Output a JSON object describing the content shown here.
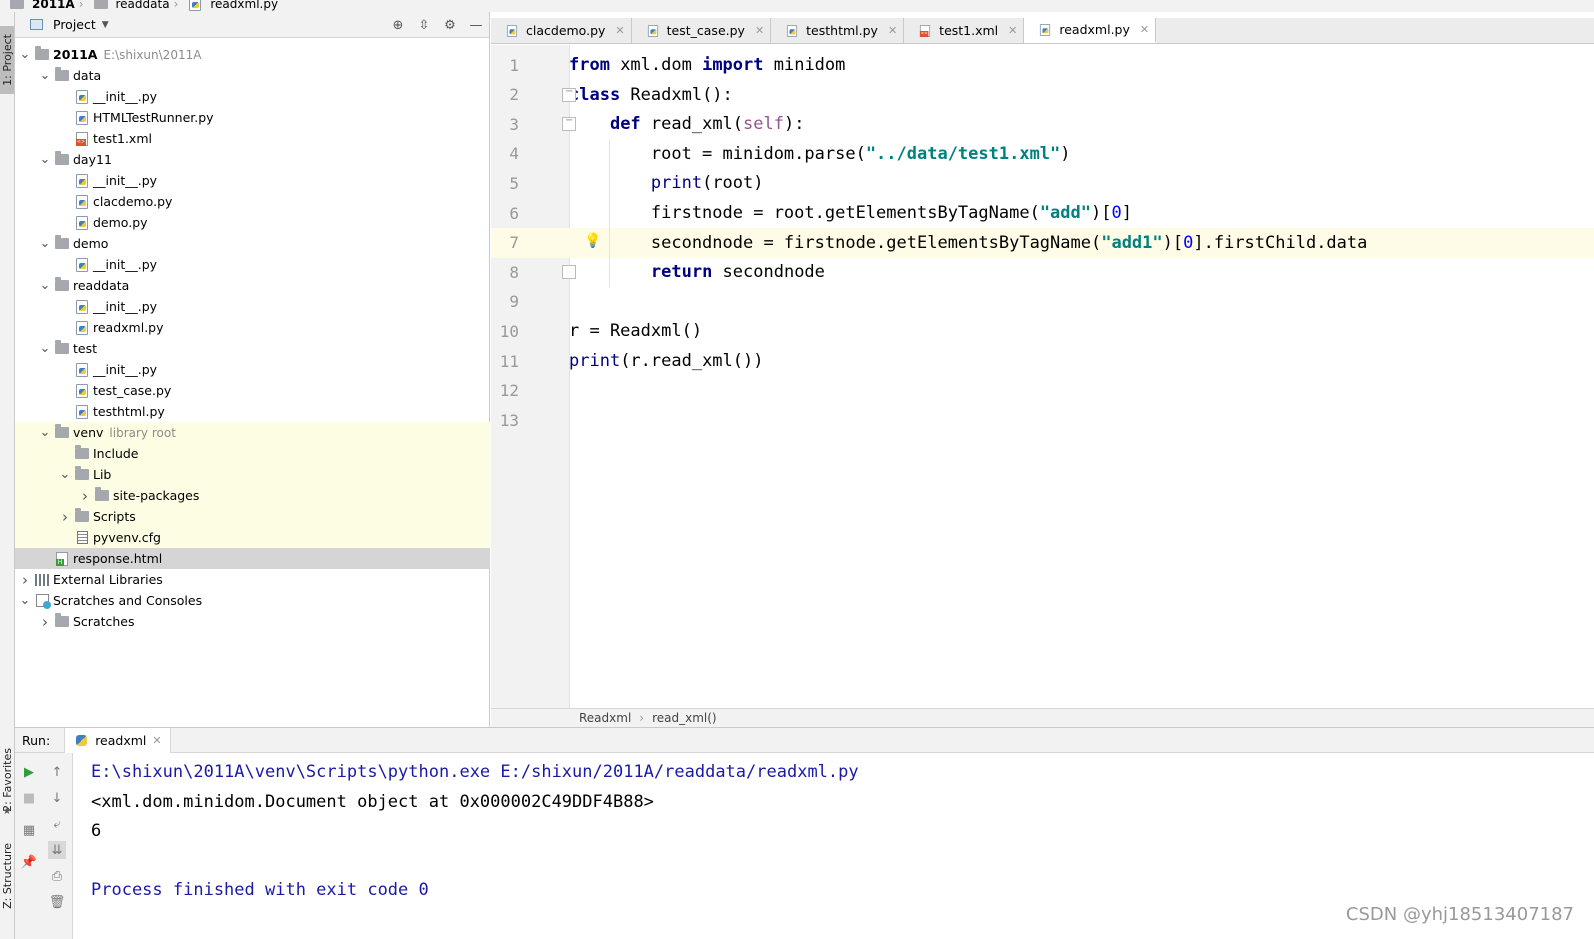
{
  "breadcrumb": [
    {
      "label": "2011A",
      "bold": true
    },
    {
      "label": "readdata",
      "bold": false
    },
    {
      "label": "readxml.py",
      "bold": false
    }
  ],
  "tool_strip": {
    "project_tab": "1: Project",
    "favorites_tab": "2: Favorites",
    "structure_tab": "Z: Structure"
  },
  "project_panel": {
    "title": "Project",
    "tree": [
      {
        "depth": 0,
        "expanded": true,
        "icon": "folder",
        "label": "2011A",
        "bold": true,
        "hint": "E:\\shixun\\2011A"
      },
      {
        "depth": 1,
        "expanded": true,
        "icon": "folder",
        "label": "data"
      },
      {
        "depth": 2,
        "icon": "python-file",
        "label": "__init__.py"
      },
      {
        "depth": 2,
        "icon": "python-file",
        "label": "HTMLTestRunner.py"
      },
      {
        "depth": 2,
        "icon": "xml-file",
        "label": "test1.xml"
      },
      {
        "depth": 1,
        "expanded": true,
        "icon": "folder",
        "label": "day11"
      },
      {
        "depth": 2,
        "icon": "python-file",
        "label": "__init__.py"
      },
      {
        "depth": 2,
        "icon": "python-file",
        "label": "clacdemo.py"
      },
      {
        "depth": 2,
        "icon": "python-file",
        "label": "demo.py"
      },
      {
        "depth": 1,
        "expanded": true,
        "icon": "folder",
        "label": "demo"
      },
      {
        "depth": 2,
        "icon": "python-file",
        "label": "__init__.py"
      },
      {
        "depth": 1,
        "expanded": true,
        "icon": "folder",
        "label": "readdata"
      },
      {
        "depth": 2,
        "icon": "python-file",
        "label": "__init__.py"
      },
      {
        "depth": 2,
        "icon": "python-file",
        "label": "readxml.py"
      },
      {
        "depth": 1,
        "expanded": true,
        "icon": "folder",
        "label": "test"
      },
      {
        "depth": 2,
        "icon": "python-file",
        "label": "__init__.py"
      },
      {
        "depth": 2,
        "icon": "python-file",
        "label": "test_case.py"
      },
      {
        "depth": 2,
        "icon": "python-file",
        "label": "testhtml.py"
      },
      {
        "depth": 1,
        "expanded": true,
        "icon": "folder",
        "label": "venv",
        "hint": "library root",
        "venv": true
      },
      {
        "depth": 2,
        "icon": "folder",
        "label": "Include",
        "venv": true
      },
      {
        "depth": 2,
        "expanded": true,
        "icon": "folder",
        "label": "Lib",
        "venv": true
      },
      {
        "depth": 3,
        "expanded": false,
        "icon": "folder",
        "label": "site-packages",
        "venv": true
      },
      {
        "depth": 2,
        "expanded": false,
        "icon": "folder",
        "label": "Scripts",
        "venv": true
      },
      {
        "depth": 2,
        "icon": "cfg-file",
        "label": "pyvenv.cfg",
        "venv": true
      },
      {
        "depth": 1,
        "icon": "html-file",
        "label": "response.html",
        "selected": true
      },
      {
        "depth": 0,
        "expanded": false,
        "icon": "library",
        "label": "External Libraries"
      },
      {
        "depth": 0,
        "expanded": true,
        "icon": "scratch",
        "label": "Scratches and Consoles"
      },
      {
        "depth": 1,
        "expanded": false,
        "icon": "folder",
        "label": "Scratches"
      }
    ]
  },
  "editor_tabs": [
    {
      "label": "clacdemo.py",
      "icon": "python-file",
      "active": false
    },
    {
      "label": "test_case.py",
      "icon": "python-file",
      "active": false
    },
    {
      "label": "testhtml.py",
      "icon": "python-file",
      "active": false
    },
    {
      "label": "test1.xml",
      "icon": "xml-file",
      "active": false
    },
    {
      "label": "readxml.py",
      "icon": "python-file",
      "active": true
    }
  ],
  "editor": {
    "current_line": 7,
    "line_numbers": [
      "1",
      "2",
      "3",
      "4",
      "5",
      "6",
      "7",
      "8",
      "9",
      "10",
      "11",
      "12",
      "13"
    ],
    "lines": [
      [
        {
          "t": "from",
          "c": "kw"
        },
        {
          "t": " xml.dom "
        },
        {
          "t": "import",
          "c": "kw"
        },
        {
          "t": " minidom"
        }
      ],
      [
        {
          "t": "class",
          "c": "kw"
        },
        {
          "t": " Readxml():"
        }
      ],
      [
        {
          "t": "    "
        },
        {
          "t": "def",
          "c": "kw"
        },
        {
          "t": " read_xml("
        },
        {
          "t": "self",
          "c": "self"
        },
        {
          "t": "):"
        }
      ],
      [
        {
          "t": "        root = minidom.parse("
        },
        {
          "t": "\"../data/test1.xml\"",
          "c": "str"
        },
        {
          "t": ")"
        }
      ],
      [
        {
          "t": "        "
        },
        {
          "t": "print",
          "c": "builtin"
        },
        {
          "t": "(root)"
        }
      ],
      [
        {
          "t": "        firstnode = root.getElementsByTagName("
        },
        {
          "t": "\"add\"",
          "c": "str"
        },
        {
          "t": ")["
        },
        {
          "t": "0",
          "c": "num"
        },
        {
          "t": "]"
        }
      ],
      [
        {
          "t": "        secondnode = firstnode.getElementsByTagName("
        },
        {
          "t": "\"add1\"",
          "c": "str"
        },
        {
          "t": ")["
        },
        {
          "t": "0",
          "c": "num"
        },
        {
          "t": "].firstChild.data"
        }
      ],
      [
        {
          "t": "        "
        },
        {
          "t": "return",
          "c": "kw"
        },
        {
          "t": " secondnode"
        }
      ],
      [],
      [
        {
          "t": "r = Readxml()"
        }
      ],
      [
        {
          "t": "print",
          "c": "builtin"
        },
        {
          "t": "(r.read_xml())"
        }
      ],
      [],
      []
    ],
    "breadcrumb": [
      "Readxml",
      "read_xml()"
    ]
  },
  "run_panel": {
    "label": "Run:",
    "tab_label": "readxml",
    "output": [
      {
        "text": "E:\\shixun\\2011A\\venv\\Scripts\\python.exe E:/shixun/2011A/readdata/readxml.py",
        "color": "#1a1aa6"
      },
      {
        "text": "<xml.dom.minidom.Document object at 0x000002C49DDF4B88>",
        "color": "#000000"
      },
      {
        "text": "6",
        "color": "#000000"
      },
      {
        "text": "",
        "color": "#000000"
      },
      {
        "text": "Process finished with exit code 0",
        "color": "#1a1aa6"
      }
    ]
  },
  "watermark": "CSDN @yhj18513407187",
  "colors": {
    "keyword": "#000080",
    "string": "#008080",
    "self": "#94558d",
    "number": "#0000ff",
    "current_line_bg": "#fefce6",
    "venv_bg": "#fdfde4",
    "selection_bg": "#d5d5d5"
  }
}
